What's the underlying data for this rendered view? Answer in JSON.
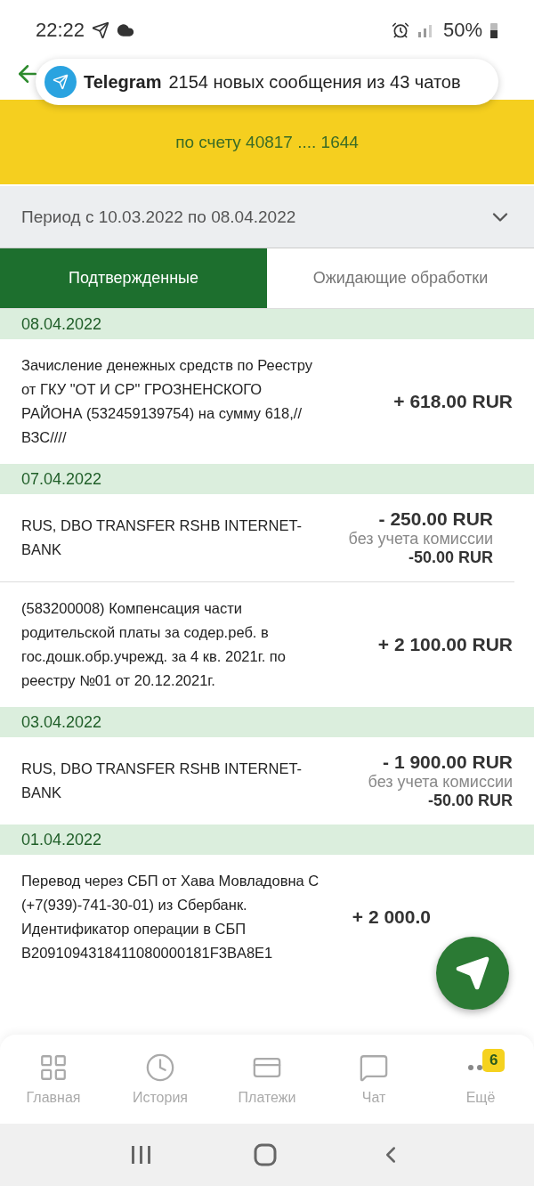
{
  "status_bar": {
    "time": "22:22",
    "battery": "50%"
  },
  "notification": {
    "app": "Telegram",
    "text": "2154 новых сообщения из 43 чатов"
  },
  "account": {
    "text": "по счету 40817 .... 1644"
  },
  "period": {
    "text": "Период с 10.03.2022 по 08.04.2022",
    "expanded": false
  },
  "tabs": [
    {
      "label": "Подтвержденные",
      "selected": true
    },
    {
      "label": "Ожидающие обработки",
      "selected": false
    }
  ],
  "groups": [
    {
      "date": "08.04.2022",
      "items": [
        {
          "description": "Зачисление денежных средств по Реестру от ГКУ \"ОТ И СР\" ГРОЗНЕНСКОГО РАЙОНА (532459139754) на сумму 618,// ВЗС////",
          "amount": "+ 618.00 RUR"
        }
      ]
    },
    {
      "date": "07.04.2022",
      "items": [
        {
          "description": "RUS, DBO TRANSFER RSHB INTERNET-BANK",
          "amount": "- 250.00 RUR",
          "note": "без учета комиссии",
          "fee": "-50.00 RUR"
        },
        {
          "description": "(583200008) Компенсация части родительской платы за содер.реб. в гос.дошк.обр.учрежд. за 4 кв. 2021г. по реестру №01 от 20.12.2021г.",
          "amount": "+ 2 100.00 RUR"
        }
      ]
    },
    {
      "date": "03.04.2022",
      "items": [
        {
          "description": "RUS, DBO TRANSFER RSHB INTERNET-BANK",
          "amount": "- 1 900.00 RUR",
          "note": "без учета комиссии",
          "fee": "-50.00 RUR"
        }
      ]
    },
    {
      "date": "01.04.2022",
      "items": [
        {
          "description": "Перевод через СБП от Хава Мовладовна С (+7(939)-741-30-01) из Сбербанк. Идентификатор операции в СБП B2091094318411080000181F3BA8E1",
          "amount": "+ 2 000.0"
        }
      ]
    }
  ],
  "bottom_nav": [
    {
      "kind": "home",
      "label": "Главная"
    },
    {
      "kind": "history",
      "label": "История"
    },
    {
      "kind": "payments",
      "label": "Платежи"
    },
    {
      "kind": "chat",
      "label": "Чат"
    },
    {
      "kind": "more",
      "label": "Ещё",
      "badge": "6"
    }
  ]
}
